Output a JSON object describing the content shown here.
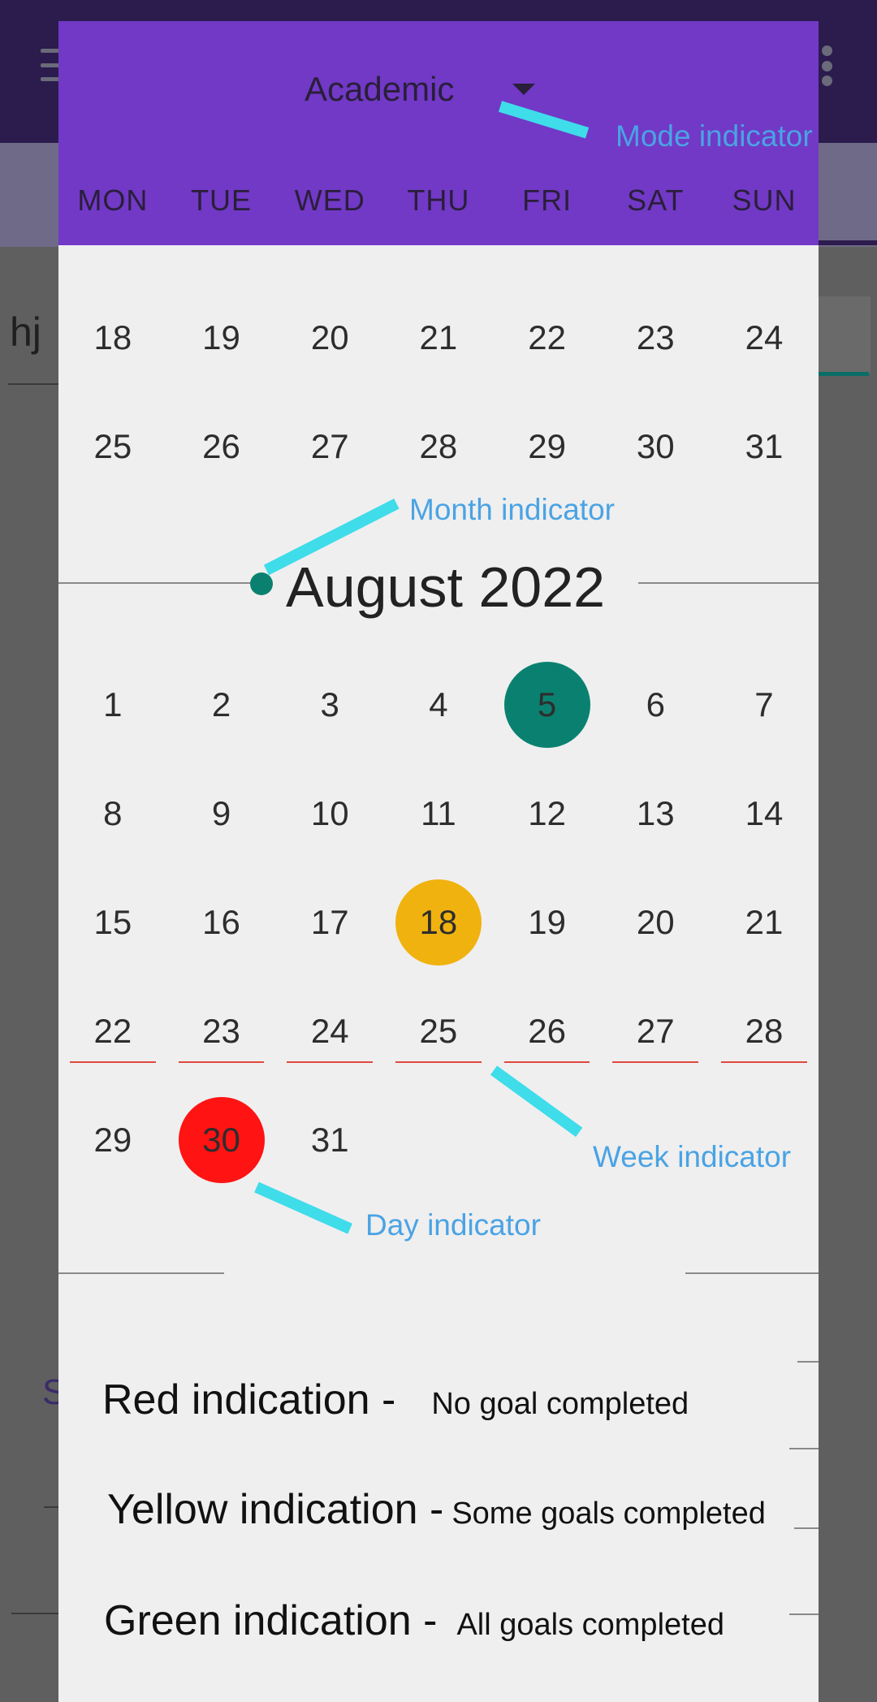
{
  "background_app": {
    "text_hj": "hj",
    "text_s": "S"
  },
  "dialog": {
    "mode": "Academic",
    "weekdays": [
      "MON",
      "TUE",
      "WED",
      "THU",
      "FRI",
      "SAT",
      "SUN"
    ],
    "prev_month_rows": [
      [
        "18",
        "19",
        "20",
        "21",
        "22",
        "23",
        "24"
      ],
      [
        "25",
        "26",
        "27",
        "28",
        "29",
        "30",
        "31"
      ]
    ],
    "month_title": "August 2022",
    "month_rows": [
      [
        "1",
        "2",
        "3",
        "4",
        "5",
        "6",
        "7"
      ],
      [
        "8",
        "9",
        "10",
        "11",
        "12",
        "13",
        "14"
      ],
      [
        "15",
        "16",
        "17",
        "18",
        "19",
        "20",
        "21"
      ],
      [
        "22",
        "23",
        "24",
        "25",
        "26",
        "27",
        "28"
      ],
      [
        "29",
        "30",
        "31"
      ]
    ],
    "highlights": {
      "green_day": "5",
      "yellow_day": "18",
      "red_day": "30",
      "underlined_week": [
        "22",
        "23",
        "24",
        "25",
        "26",
        "27",
        "28"
      ]
    },
    "colors": {
      "header": "#7139c6",
      "green": "#0a8170",
      "yellow": "#f0b20e",
      "red": "#ff1313",
      "week_underline": "#e0483f",
      "annotation_line": "#3fdcea",
      "annotation_text": "#4aa3e4"
    },
    "legend": [
      {
        "title": "Red indication -",
        "desc": "No goal completed"
      },
      {
        "title": "Yellow indication -",
        "desc": "Some goals completed"
      },
      {
        "title": "Green indication -",
        "desc": "All goals completed"
      }
    ]
  },
  "annotations": {
    "mode": "Mode indicator",
    "month": "Month indicator",
    "week": "Week indicator",
    "day": "Day indicator"
  }
}
